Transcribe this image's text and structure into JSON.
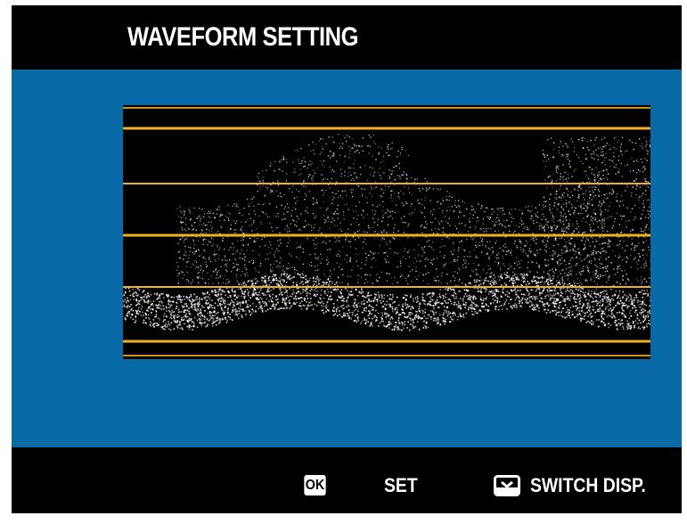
{
  "header": {
    "title": "WAVEFORM SETTING"
  },
  "colors": {
    "panel_background": "#0a6aa8",
    "guide_line": "#f0b020",
    "waveform_trace": "#ffffff"
  },
  "footer": {
    "ok_icon_label": "OK",
    "set_label": "SET",
    "disp_icon": "disp-button-icon",
    "switch_label": "SWITCH DISP."
  }
}
